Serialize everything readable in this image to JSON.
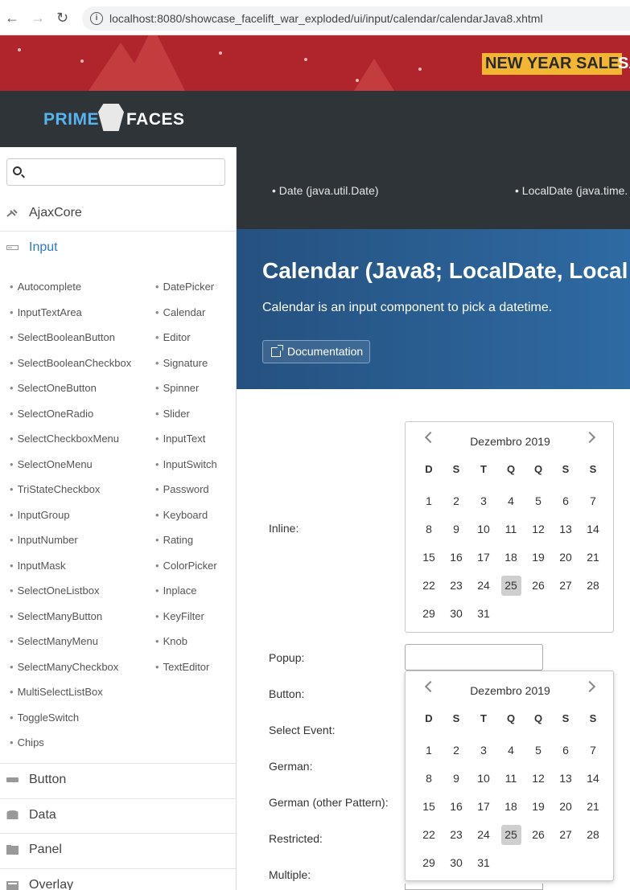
{
  "browser": {
    "url": "localhost:8080/showcase_facelift_war_exploded/ui/input/calendar/calendarJava8.xhtml"
  },
  "banner": {
    "sale_label": "NEW YEAR SALE",
    "sale_tail": "SA"
  },
  "header": {
    "logo_prime": "PRIME",
    "logo_faces": "FACES"
  },
  "sidebar": {
    "search_value": "",
    "menu": [
      {
        "label": "AjaxCore",
        "icon": "plug-icon"
      },
      {
        "label": "Input",
        "icon": "input-icon"
      },
      {
        "label": "Button",
        "icon": "button-icon"
      },
      {
        "label": "Data",
        "icon": "database-icon"
      },
      {
        "label": "Panel",
        "icon": "panel-icon"
      },
      {
        "label": "Overlay",
        "icon": "overlay-icon"
      }
    ],
    "input_col1": [
      "Autocomplete",
      "InputTextArea",
      "SelectBooleanButton",
      "SelectBooleanCheckbox",
      "SelectOneButton",
      "SelectOneRadio",
      "SelectCheckboxMenu",
      "SelectOneMenu",
      "TriStateCheckbox",
      "InputGroup",
      "InputNumber",
      "InputMask",
      "SelectOneListbox",
      "SelectManyButton",
      "SelectManyMenu",
      "SelectManyCheckbox",
      "MultiSelectListBox",
      "ToggleSwitch",
      "Chips"
    ],
    "input_col2": [
      "DatePicker",
      "Calendar",
      "Editor",
      "Signature",
      "Spinner",
      "Slider",
      "InputText",
      "InputSwitch",
      "Password",
      "Keyboard",
      "Rating",
      "ColorPicker",
      "Inplace",
      "KeyFilter",
      "Knob",
      "TextEditor"
    ]
  },
  "main": {
    "tabs": [
      "Date (java.util.Date)",
      "LocalDate (java.time."
    ],
    "title": "Calendar (Java8; LocalDate, Local",
    "description": "Calendar is an input component to pick a datetime.",
    "doc_button": "Documentation",
    "labels": [
      "Inline:",
      "Popup:",
      "Button:",
      "Select Event:",
      "German:",
      "German (other Pattern):",
      "Restricted:",
      "Multiple:"
    ],
    "popup_value": ""
  },
  "calendar": {
    "month_title": "Dezembro 2019",
    "weekdays": [
      "D",
      "S",
      "T",
      "Q",
      "Q",
      "S",
      "S"
    ],
    "weeks": [
      [
        "1",
        "2",
        "3",
        "4",
        "5",
        "6",
        "7"
      ],
      [
        "8",
        "9",
        "10",
        "11",
        "12",
        "13",
        "14"
      ],
      [
        "15",
        "16",
        "17",
        "18",
        "19",
        "20",
        "21"
      ],
      [
        "22",
        "23",
        "24",
        "25",
        "26",
        "27",
        "28"
      ],
      [
        "29",
        "30",
        "31",
        "",
        "",
        "",
        ""
      ]
    ],
    "today": "25"
  },
  "colors": {
    "banner": "#b0252b",
    "sale_yellow": "#f2b632",
    "dark_header": "#2f3438",
    "hero_blue": "#2e6aa3",
    "logo_blue": "#56b4ef"
  }
}
